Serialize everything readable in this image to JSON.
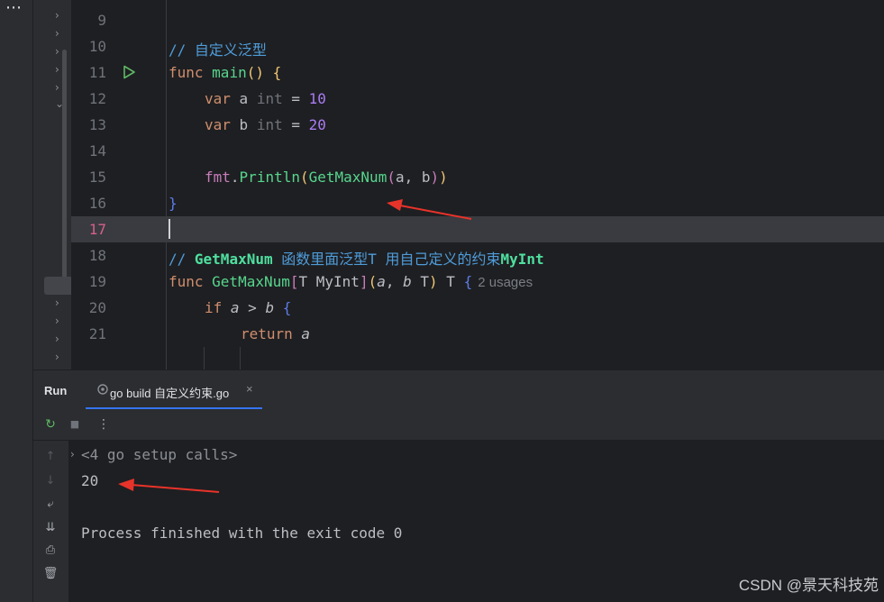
{
  "sidebar": {
    "more_icon": "⋯"
  },
  "editor": {
    "lines": [
      {
        "n": "9"
      },
      {
        "n": "10"
      },
      {
        "n": "11"
      },
      {
        "n": "12"
      },
      {
        "n": "13"
      },
      {
        "n": "14"
      },
      {
        "n": "15"
      },
      {
        "n": "16"
      },
      {
        "n": "17"
      },
      {
        "n": "18"
      },
      {
        "n": "19"
      },
      {
        "n": "20"
      },
      {
        "n": "21"
      }
    ],
    "code": {
      "l10": "// 自定义泛型",
      "l11_kw": "func",
      "l11_fn": "main",
      "l11_rest": "() {",
      "l12_kw": "var",
      "l12_name": " a ",
      "l12_type": "int",
      "l12_eq": " = ",
      "l12_num": "10",
      "l13_kw": "var",
      "l13_name": " b ",
      "l13_type": "int",
      "l13_eq": " = ",
      "l13_num": "20",
      "l15_pkg": "fmt",
      "l15_dot": ".",
      "l15_fn": "Println",
      "l15_p1": "(",
      "l15_fn2": "GetMaxNum",
      "l15_p2": "(",
      "l15_args": "a, b",
      "l15_p3": ")",
      "l15_p4": ")",
      "l16": "}",
      "l18_prefix": "// ",
      "l18_bold": "GetMaxNum",
      "l18_text": " 函数里面泛型T 用自己定义的约束",
      "l18_bold2": "MyInt",
      "l19_kw": "func",
      "l19_fn": " GetMaxNum",
      "l19_b1": "[",
      "l19_tp": "T MyInt",
      "l19_b2": "]",
      "l19_p1": "(",
      "l19_a": "a",
      "l19_comma": ", ",
      "l19_b": "b",
      "l19_t": " T",
      "l19_p2": ")",
      "l19_ret": " T ",
      "l19_brace": "{",
      "l19_hint": "2 usages",
      "l20_kw": "if",
      "l20_a": " a",
      "l20_op": " > ",
      "l20_b": "b",
      "l20_brace": " {",
      "l21_kw": "return",
      "l21_a": " a"
    }
  },
  "run_panel": {
    "title": "Run",
    "tab_label": "go build 自定义约束.go",
    "tab_close": "×",
    "toolbar": {
      "rerun_icon": "↻",
      "stop_icon": "■",
      "more_icon": "⋮"
    },
    "side": {
      "up_icon": "↑",
      "down_icon": "↓",
      "wrap_icon": "⤶",
      "scroll_end_icon": "⇊",
      "print_icon": "⎙",
      "trash_icon": "🗑"
    },
    "console": {
      "chevron": "›",
      "setup_calls": "<4 go setup calls>",
      "output": "20",
      "finished": "Process finished with the exit code 0"
    }
  },
  "watermark": "CSDN @景天科技苑",
  "colors": {
    "accent": "#3574f0",
    "arrow": "#e8332a",
    "run_green": "#5fb865"
  }
}
